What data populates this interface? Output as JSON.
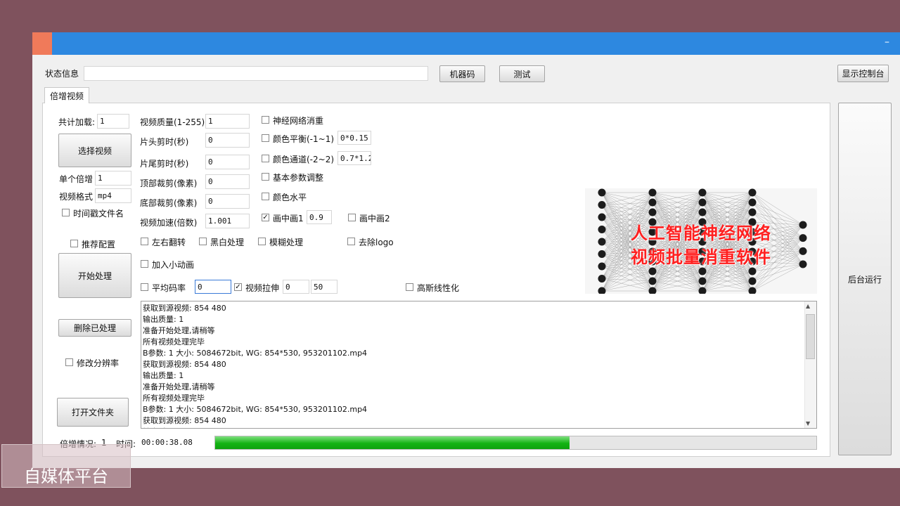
{
  "top": {
    "status_label": "状态信息",
    "status_value": "",
    "machine_code_button": "机器码",
    "test_button": "测试",
    "console_button": "显示控制台"
  },
  "tab": {
    "label": "倍增视频"
  },
  "left": {
    "total_label": "共计加载:",
    "total_value": "1",
    "select_video_button": "选择视频",
    "single_multiplier_label": "单个倍增",
    "single_multiplier_value": "1",
    "video_format_label": "视频格式",
    "video_format_value": "mp4",
    "timestamp_filename_label": "时间戳文件名",
    "recommended_config_label": "推荐配置",
    "start_button": "开始处理",
    "delete_processed_button": "删除已处理",
    "modify_resolution_label": "修改分辨率",
    "open_folder_button": "打开文件夹"
  },
  "params": {
    "quality_label": "视频质量(1-255)",
    "quality_value": "1",
    "head_cut_label": "片头剪时(秒)",
    "head_cut_value": "0",
    "tail_cut_label": "片尾剪时(秒)",
    "tail_cut_value": "0",
    "top_crop_label": "顶部裁剪(像素)",
    "top_crop_value": "0",
    "bottom_crop_label": "底部裁剪(像素)",
    "bottom_crop_value": "0",
    "speed_label": "视频加速(倍数)",
    "speed_value": "1.001"
  },
  "options": {
    "neural_dedup": "神经网络消重",
    "color_balance": "颜色平衡(-1~1)",
    "color_balance_value": "0*0.15",
    "color_channel": "颜色通道(-2~2)",
    "color_channel_value": "0.7*1.2",
    "basic_params": "基本参数调整",
    "color_level": "颜色水平",
    "pip1": "画中画1",
    "pip1_value": "0.9",
    "pip2": "画中画2",
    "flip_lr": "左右翻转",
    "black_white": "黑白处理",
    "blur": "模糊处理",
    "remove_logo": "去除logo",
    "add_animation": "加入小动画",
    "avg_bitrate": "平均码率",
    "avg_bitrate_value": "0",
    "video_stretch": "视频拉伸",
    "stretch_a": "0",
    "stretch_b": "50",
    "gauss_linear": "高斯线性化"
  },
  "banner": {
    "line1": "人工智能神经网络",
    "line2": "视频批量消重软件"
  },
  "log": {
    "lines": [
      "获取到源视频: 854  480",
      "输出质量: 1",
      "准备开始处理,请稍等",
      "所有视频处理完毕",
      "B参数: 1  大小: 5084672bit, WG: 854*530,  953201102.mp4",
      "获取到源视频: 854  480",
      "输出质量: 1",
      "准备开始处理,请稍等",
      "所有视频处理完毕",
      "B参数: 1  大小: 5084672bit, WG: 854*530,  953201102.mp4",
      "获取到源视频: 854  480",
      "输出质量: 1"
    ]
  },
  "footer": {
    "multiply_status_label": "倍增情况:",
    "multiply_status_value": "1",
    "time_label": "时间:",
    "time_value": "00:00:38.08",
    "progress_fraction": 0.59
  },
  "side": {
    "background_run_button": "后台运行"
  },
  "overlay": {
    "text": "自媒体平台"
  },
  "colors": {
    "desktop": "#7f525d",
    "titlebar": "#2d88e0",
    "progress": "#13b313",
    "banner_text": "#ff2020"
  }
}
